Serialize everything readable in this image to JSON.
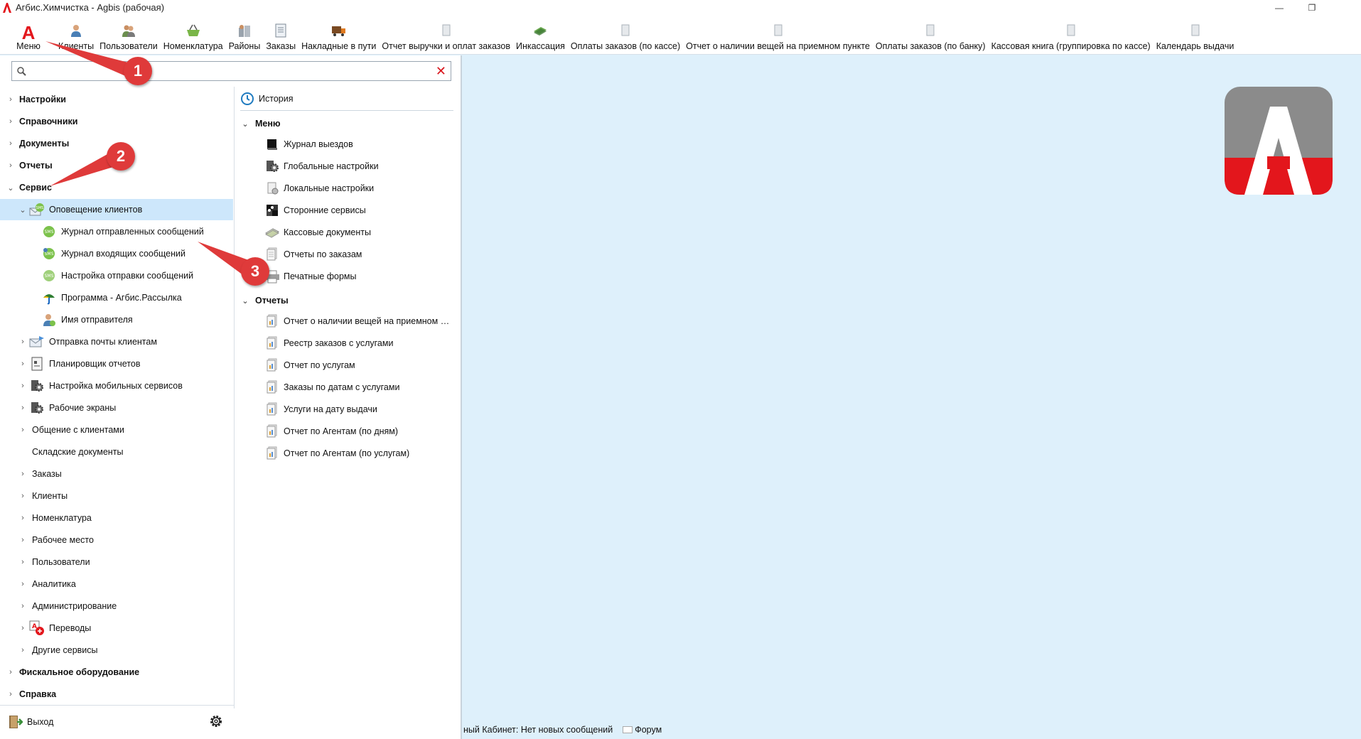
{
  "window": {
    "title": "Агбис.Химчистка - Agbis (рабочая)",
    "minimize_glyph": "—",
    "restore_glyph": "❐",
    "close_glyph": ""
  },
  "toolbar": {
    "menu_label": "Меню",
    "menu_glyph": "A",
    "items": [
      {
        "label": "Клиенты",
        "icon": "user-icon"
      },
      {
        "label": "Пользователи",
        "icon": "users-icon"
      },
      {
        "label": "Номенклатура",
        "icon": "basket-icon"
      },
      {
        "label": "Районы",
        "icon": "buildings-icon"
      },
      {
        "label": "Заказы",
        "icon": "document-icon"
      },
      {
        "label": "Накладные в пути",
        "icon": "truck-icon"
      },
      {
        "label": "Отчет выручки и оплат заказов",
        "icon": "report-icon"
      },
      {
        "label": "Инкассация",
        "icon": "money-icon"
      },
      {
        "label": "Оплаты заказов (по кассе)",
        "icon": "report-icon"
      },
      {
        "label": "Отчет о наличии вещей на приемном пункте",
        "icon": "report-icon"
      },
      {
        "label": "Оплаты заказов (по банку)",
        "icon": "report-icon"
      },
      {
        "label": "Кассовая книга (группировка по кассе)",
        "icon": "report-icon"
      },
      {
        "label": "Календарь выдачи",
        "icon": "report-icon"
      }
    ]
  },
  "search": {
    "value": "",
    "placeholder": "",
    "clear_glyph": "✕"
  },
  "nav": {
    "root": [
      {
        "label": "Настройки",
        "expanded": false
      },
      {
        "label": "Справочники",
        "expanded": false
      },
      {
        "label": "Документы",
        "expanded": false
      },
      {
        "label": "Отчеты",
        "expanded": false
      },
      {
        "label": "Сервис",
        "expanded": true
      },
      {
        "label": "Фискальное оборудование",
        "expanded": false
      },
      {
        "label": "Справка",
        "expanded": false
      }
    ],
    "service_children": [
      {
        "label": "Оповещение клиентов",
        "expanded": true,
        "selected": true,
        "icon": "sms-envelope-icon"
      },
      {
        "label": "Отправка почты клиентам",
        "icon": "mail-icon"
      },
      {
        "label": "Планировщик отчетов",
        "icon": "scheduler-icon"
      },
      {
        "label": "Настройка мобильных сервисов",
        "icon": "settings-icon"
      },
      {
        "label": "Рабочие экраны",
        "icon": "settings-icon"
      },
      {
        "label": "Общение с клиентами",
        "icon": ""
      },
      {
        "label": "Складские документы",
        "icon": ""
      },
      {
        "label": "Заказы",
        "icon": ""
      },
      {
        "label": "Клиенты",
        "icon": ""
      },
      {
        "label": "Номенклатура",
        "icon": ""
      },
      {
        "label": "Рабочее место",
        "icon": ""
      },
      {
        "label": "Пользователи",
        "icon": ""
      },
      {
        "label": "Аналитика",
        "icon": ""
      },
      {
        "label": "Администрирование",
        "icon": ""
      },
      {
        "label": "Переводы",
        "icon": "translate-icon"
      },
      {
        "label": "Другие сервисы",
        "icon": ""
      }
    ],
    "notify_children": [
      {
        "label": "Журнал отправленных сообщений",
        "icon": "sms-icon"
      },
      {
        "label": "Журнал входящих сообщений",
        "icon": "sms-icon"
      },
      {
        "label": "Настройка отправки сообщений",
        "icon": "sms-icon"
      },
      {
        "label": "Программа - Агбис.Рассылка",
        "icon": "umbrella-icon"
      },
      {
        "label": "Имя отправителя",
        "icon": "user-icon"
      }
    ],
    "exit_label": "Выход"
  },
  "middle": {
    "history_label": "История",
    "menu_section": "Меню",
    "menu_items": [
      {
        "label": "Журнал выездов",
        "icon": "book-icon"
      },
      {
        "label": "Глобальные настройки",
        "icon": "settings-icon"
      },
      {
        "label": "Локальные настройки",
        "icon": "page-settings-icon"
      },
      {
        "label": "Сторонние сервисы",
        "icon": "puzzle-icon"
      },
      {
        "label": "Кассовые документы",
        "icon": "cash-icon"
      },
      {
        "label": "Отчеты по заказам",
        "icon": "reports-icon"
      },
      {
        "label": "Печатные формы",
        "icon": "printer-icon"
      }
    ],
    "reports_section": "Отчеты",
    "report_items": [
      {
        "label": "Отчет о наличии вещей на приемном пункте",
        "icon": "report-icon"
      },
      {
        "label": "Реестр заказов с услугами",
        "icon": "report-icon"
      },
      {
        "label": "Отчет по услугам",
        "icon": "report-icon"
      },
      {
        "label": "Заказы по датам с услугами",
        "icon": "report-icon"
      },
      {
        "label": "Услуги на дату выдачи",
        "icon": "report-icon"
      },
      {
        "label": "Отчет по Агентам (по дням)",
        "icon": "report-icon"
      },
      {
        "label": "Отчет по Агентам (по услугам)",
        "icon": "report-icon"
      }
    ]
  },
  "status": {
    "cabinet_text": "ный Кабинет: Нет новых сообщений",
    "forum_label": "Форум"
  },
  "annotations": [
    "1",
    "2",
    "3"
  ],
  "colors": {
    "brand_red": "#e3161c",
    "callout_red": "#df3a3a",
    "workspace": "#def0fb",
    "selection": "#cde7fb"
  }
}
